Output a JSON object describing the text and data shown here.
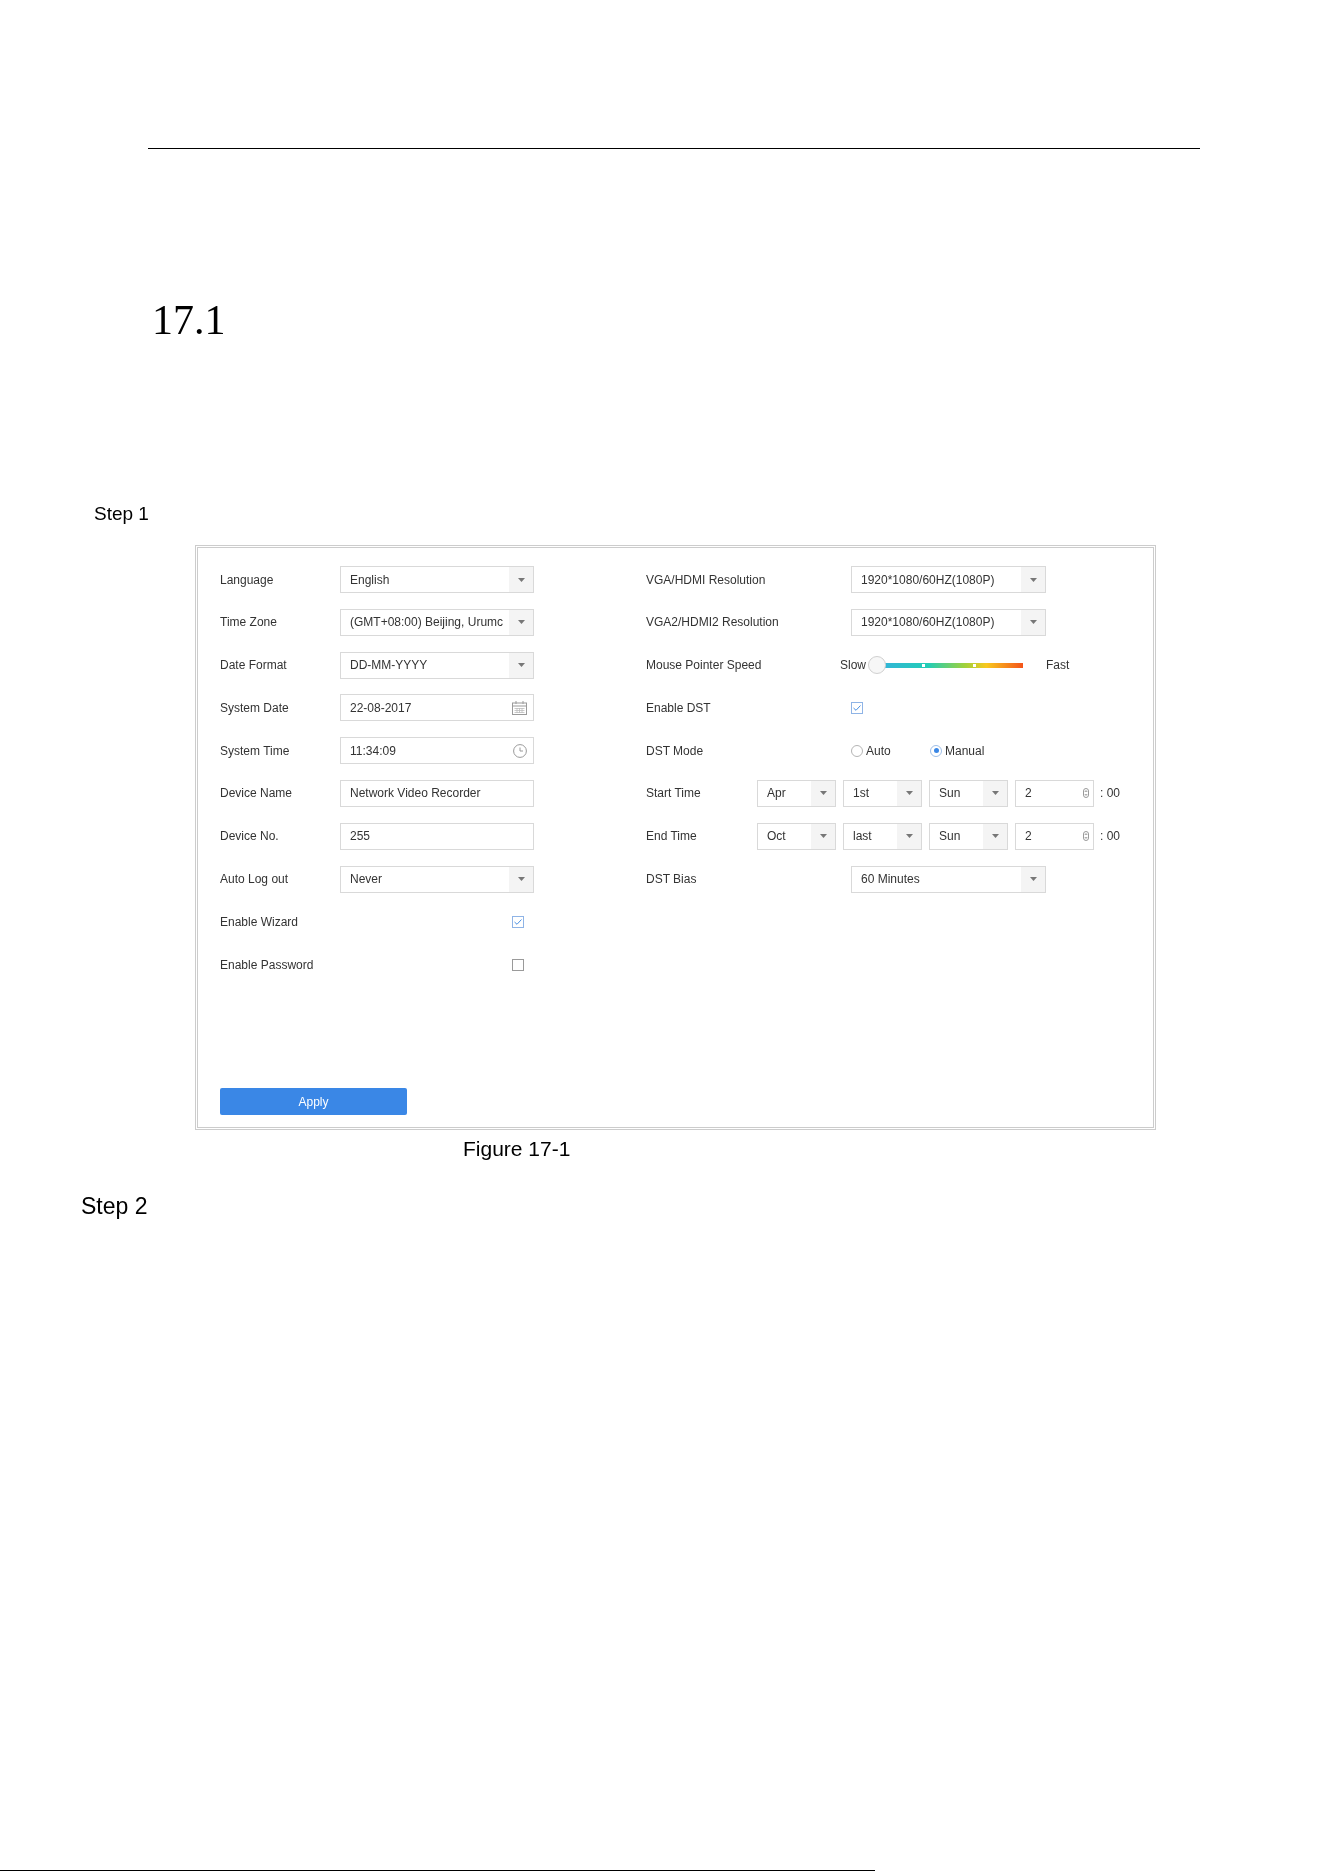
{
  "section_heading": {
    "number": "17.1"
  },
  "step_1": {
    "label": "Step 1"
  },
  "settings_panel": {
    "left_fields": [
      {
        "kind": "select",
        "label": "Language",
        "value": "English"
      },
      {
        "kind": "select",
        "label": "Time Zone",
        "value": "(GMT+08:00) Beijing, Urumc"
      },
      {
        "kind": "select",
        "label": "Date Format",
        "value": "DD-MM-YYYY"
      },
      {
        "kind": "date",
        "label": "System Date",
        "value": "22-08-2017"
      },
      {
        "kind": "time",
        "label": "System Time",
        "value": "11:34:09"
      },
      {
        "kind": "text",
        "label": "Device Name",
        "value": "Network Video Recorder"
      },
      {
        "kind": "text",
        "label": "Device No.",
        "value": "255"
      },
      {
        "kind": "select",
        "label": "Auto Log out",
        "value": "Never"
      },
      {
        "kind": "checkbox",
        "label": "Enable Wizard",
        "checked": true
      },
      {
        "kind": "checkbox",
        "label": "Enable Password",
        "checked": false
      }
    ],
    "right_fields": [
      {
        "kind": "select",
        "label": "VGA/HDMI Resolution",
        "value": "1920*1080/60HZ(1080P)"
      },
      {
        "kind": "select",
        "label": "VGA2/HDMI2 Resolution",
        "value": "1920*1080/60HZ(1080P)"
      },
      {
        "kind": "slider",
        "label": "Mouse Pointer Speed",
        "min_label": "Slow",
        "max_label": "Fast",
        "level": 0
      },
      {
        "kind": "checkbox",
        "label": "Enable DST",
        "checked": true
      },
      {
        "kind": "radio",
        "label": "DST Mode",
        "options": [
          {
            "label": "Auto",
            "selected": false
          },
          {
            "label": "Manual",
            "selected": true
          }
        ]
      },
      {
        "kind": "dst_rule",
        "label": "Start Time",
        "month": "Apr",
        "week": "1st",
        "weekday": "Sun",
        "hour": "2",
        "minutes": ": 00"
      },
      {
        "kind": "dst_rule",
        "label": "End Time",
        "month": "Oct",
        "week": "last",
        "weekday": "Sun",
        "hour": "2",
        "minutes": ": 00"
      },
      {
        "kind": "select",
        "label": "DST Bias",
        "value": "60 Minutes"
      }
    ],
    "apply_button": {
      "label": "Apply"
    }
  },
  "figure_caption": {
    "text": "Figure 17-1"
  },
  "step_2": {
    "label": "Step 2"
  }
}
